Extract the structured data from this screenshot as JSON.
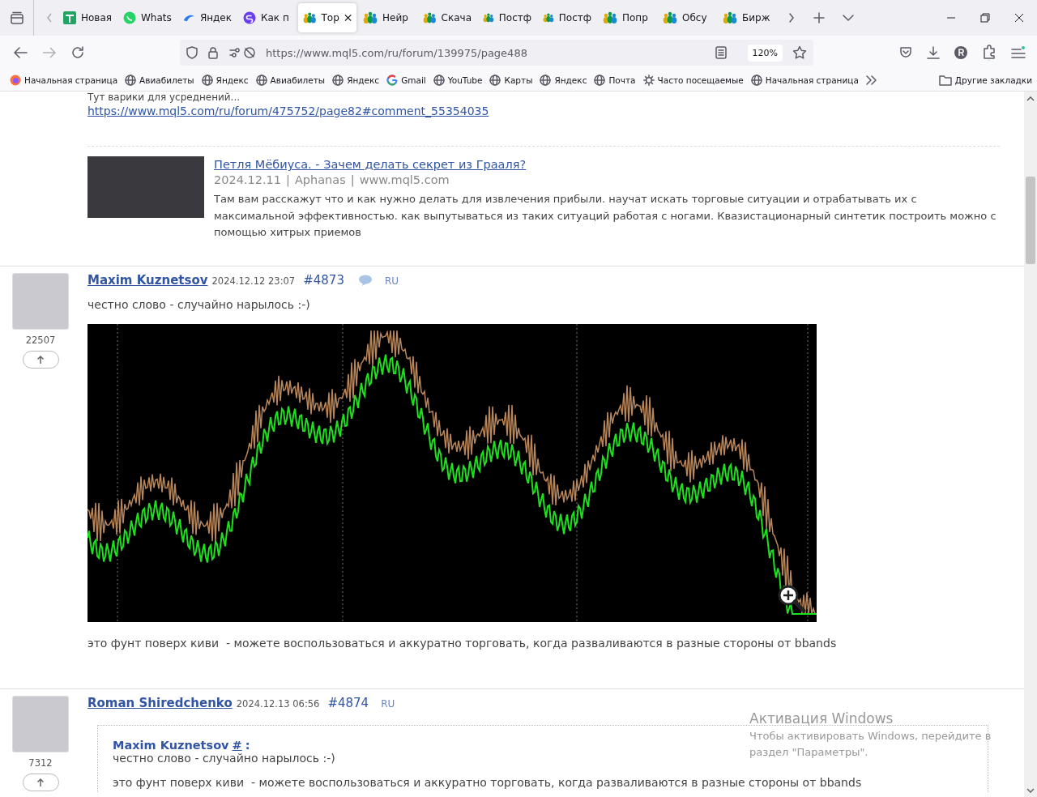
{
  "tabs": [
    {
      "title": "Новая",
      "kind": "sheet",
      "selected": false
    },
    {
      "title": "Whats",
      "kind": "chat",
      "selected": false
    },
    {
      "title": "Яндек",
      "kind": "cloud",
      "selected": false
    },
    {
      "title": "Как п",
      "kind": "purple",
      "selected": false
    },
    {
      "title": "Тор",
      "kind": "people",
      "selected": true
    },
    {
      "title": "Нейр",
      "kind": "people",
      "selected": false
    },
    {
      "title": "Скача",
      "kind": "people",
      "selected": false
    },
    {
      "title": "Постф",
      "kind": "people",
      "selected": false
    },
    {
      "title": "Постф",
      "kind": "people",
      "selected": false
    },
    {
      "title": "Попр",
      "kind": "people",
      "selected": false
    },
    {
      "title": "Обсу",
      "kind": "people",
      "selected": false
    },
    {
      "title": "Бирж",
      "kind": "people",
      "selected": false
    }
  ],
  "address_bar": {
    "url": "https://www.mql5.com/ru/forum/139975/page488",
    "zoom": "120%"
  },
  "bookmarks": [
    {
      "label": "Начальная страница",
      "kind": "firefox"
    },
    {
      "label": "Авиабилеты",
      "kind": "globe"
    },
    {
      "label": "Яндекс",
      "kind": "globe"
    },
    {
      "label": "Авиабилеты",
      "kind": "globe"
    },
    {
      "label": "Яндекс",
      "kind": "globe"
    },
    {
      "label": "Gmail",
      "kind": "google"
    },
    {
      "label": "YouTube",
      "kind": "globe"
    },
    {
      "label": "Карты",
      "kind": "globe"
    },
    {
      "label": "Яндекс",
      "kind": "globe"
    },
    {
      "label": "Почта",
      "kind": "globe"
    },
    {
      "label": "Часто посещаемые",
      "kind": "gear"
    },
    {
      "label": "Начальная страница",
      "kind": "globe"
    }
  ],
  "other_bookmarks": "Другие закладки",
  "previous_post": {
    "text": "Тут варики для усреднений...",
    "link": "https://www.mql5.com/ru/forum/475752/page82#comment_55354035",
    "preview": {
      "title": "Петля Мёбиуса. - Зачем делать секрет из Грааля?",
      "meta": [
        "2024.12.11",
        "|",
        "Aphanas",
        "|",
        "www.mql5.com"
      ],
      "description": "Там вам расскажут что и как нужно делать для извлечения прибыли. научат искать торговые ситуации и отрабатывать их с максимальной эффективностью. как выпутываться из таких ситуаций работая с ногами. Квазистационарный синтетик построить можно с помощью хитрых приемов"
    }
  },
  "posts": [
    {
      "author": "Maxim Kuznetsov",
      "date": "2024.12.12 23:07",
      "number": "#4873",
      "translate_icon": true,
      "language": "RU",
      "rating": "22507",
      "blocks": [
        {
          "kind": "text",
          "text": "честно слово - случайно нарылось :-)"
        },
        {
          "kind": "chart"
        },
        {
          "kind": "text",
          "text": "это фунт поверх киви  - можете воспользоваться и аккуратно торговать, когда разваливаются в разные стороны от bbands"
        }
      ]
    },
    {
      "author": "Roman Shiredchenko",
      "date": "2024.12.13 06:56",
      "number": "#4874",
      "translate_icon": false,
      "language": "RU",
      "rating": "7312",
      "blocks": [
        {
          "kind": "quote",
          "author": "Maxim Kuznetsov",
          "link": "#",
          "suffix": ":",
          "lines": [
            "честно слово - случайно нарылось :-)",
            "это фунт поверх киви  - можете воспользоваться и аккуратно торговать, когда разваливаются в разные стороны от bbands"
          ]
        }
      ]
    }
  ],
  "os_notice": {
    "title": "Активация Windows",
    "text": "Чтобы активировать Windows, перейдите в раздел \"Параметры\"."
  }
}
